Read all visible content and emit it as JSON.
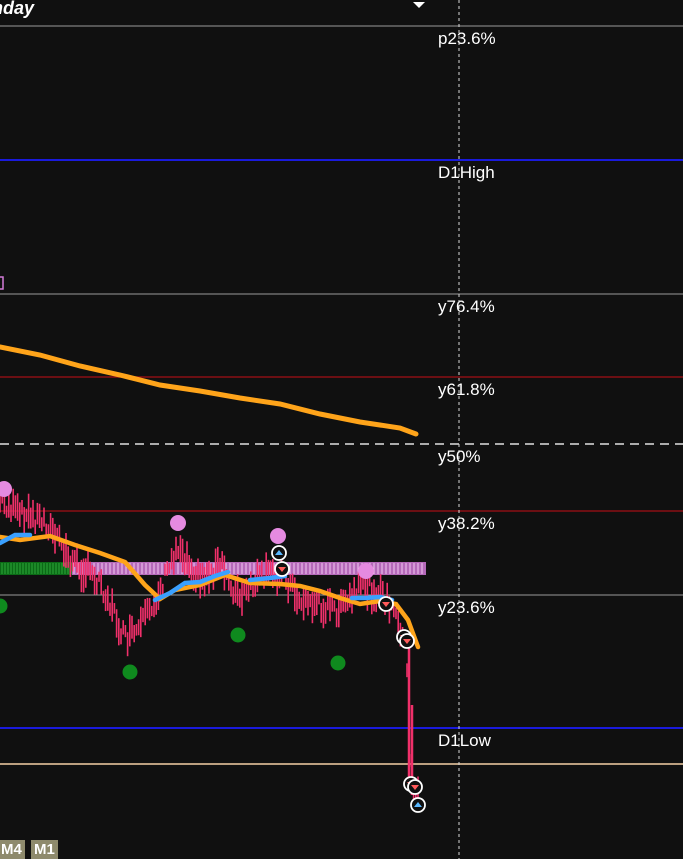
{
  "header": {
    "title_fragment": "nday"
  },
  "timeframes": [
    {
      "label": "M4"
    },
    {
      "label": "M1"
    }
  ],
  "colors": {
    "background": "#101010",
    "grid_line": "#9a9a9a",
    "blue_line": "#1a1adc",
    "red_line": "#8a0f14",
    "price_line": "#f4cfa6",
    "slow_ma": "#ffa41a",
    "fast_ma": "#3aa0ff",
    "candle": "#f0306a",
    "pink_dot": "#e58ae0",
    "green_dot": "#0f8a1e",
    "band": "#d27ad8",
    "band_green": "#0b6a16"
  },
  "chart_data": {
    "type": "line",
    "levels": [
      {
        "label": "p23.6%",
        "style": "gray"
      },
      {
        "label": "D1High",
        "style": "blue"
      },
      {
        "label": "y76.4%",
        "style": "gray"
      },
      {
        "label": "y61.8%",
        "style": "red"
      },
      {
        "label": "y50%",
        "style": "dashed"
      },
      {
        "label": "y38.2%",
        "style": "red"
      },
      {
        "label": "y23.6%",
        "style": "gray"
      },
      {
        "label": "D1Low",
        "style": "blue"
      }
    ],
    "series": [
      {
        "name": "",
        "kind": "slow-ma"
      },
      {
        "name": "",
        "kind": "fast-ma"
      },
      {
        "name": "",
        "kind": "price"
      }
    ]
  }
}
